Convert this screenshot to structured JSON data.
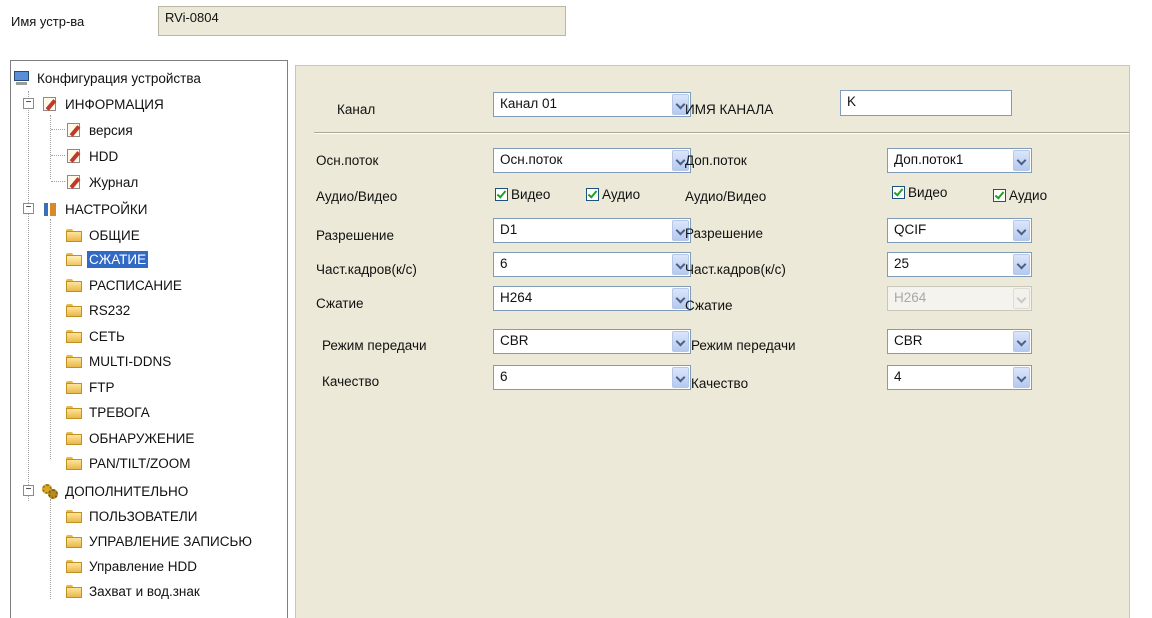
{
  "device": {
    "label": "Имя устр-ва",
    "name": "RVi-0804"
  },
  "tree": {
    "root": "Конфигурация устройства",
    "info": {
      "label": "ИНФОРМАЦИЯ",
      "items": [
        "версия",
        "HDD",
        "Журнал"
      ]
    },
    "settings": {
      "label": "НАСТРОЙКИ",
      "items": [
        "ОБЩИЕ",
        "СЖАТИЕ",
        "РАСПИСАНИЕ",
        "RS232",
        "СЕТЬ",
        "MULTI-DDNS",
        "FTP",
        "ТРЕВОГА",
        "ОБНАРУЖЕНИЕ",
        "PAN/TILT/ZOOM"
      ]
    },
    "advanced": {
      "label": "ДОПОЛНИТЕЛЬНО",
      "items": [
        "ПОЛЬЗОВАТЕЛИ",
        "УПРАВЛЕНИЕ ЗАПИСЬЮ",
        "Управление HDD",
        "Захват и вод.знак"
      ]
    },
    "selected": "СЖАТИЕ"
  },
  "channel": {
    "label": "Канал",
    "value": "Канал 01",
    "name_label": "ИМЯ КАНАЛА",
    "name_value": "K"
  },
  "main_stream": {
    "stream_label": "Осн.поток",
    "stream_value": "Осн.поток",
    "av_label": "Аудио/Видео",
    "video": "Видео",
    "audio": "Аудио",
    "res_label": "Разрешение",
    "res_value": "D1",
    "fps_label": "Част.кадров(к/с)",
    "fps_value": "6",
    "comp_label": "Сжатие",
    "comp_value": "H264",
    "mode_label": "Режим передачи",
    "mode_value": "CBR",
    "quality_label": "Качество",
    "quality_value": "6"
  },
  "sub_stream": {
    "stream_label": "Доп.поток",
    "stream_value": "Доп.поток1",
    "av_label": "Аудио/Видео",
    "video": "Видео",
    "audio": "Аудио",
    "res_label": "Разрешение",
    "res_value": "QCIF",
    "fps_label": "Част.кадров(к/с)",
    "fps_value": "25",
    "comp_label": "Сжатие",
    "comp_value": "H264",
    "mode_label": "Режим передачи",
    "mode_value": "CBR",
    "quality_label": "Качество",
    "quality_value": "4"
  }
}
